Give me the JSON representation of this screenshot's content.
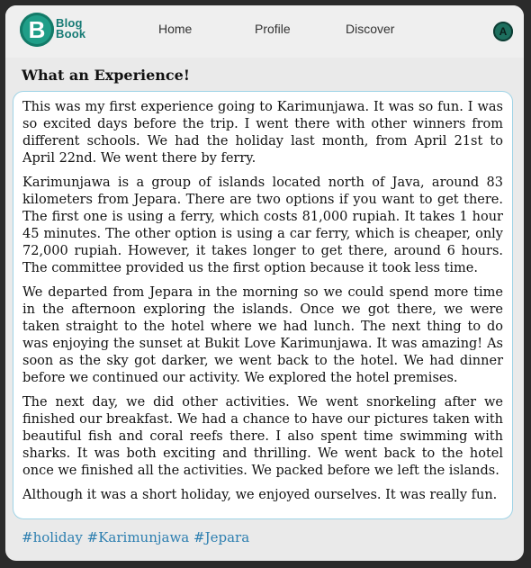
{
  "header": {
    "logo": {
      "mark": "B",
      "line1": "Blog",
      "line2": "Book"
    },
    "nav": {
      "home": "Home",
      "profile": "Profile",
      "discover": "Discover"
    },
    "avatar": "A"
  },
  "post": {
    "title": "What an Experience!",
    "paragraphs": [
      "This was my first experience going to Karimunjawa. It was so fun. I was so excited days before the trip. I went there with other winners from different schools. We had the holiday last month, from April 21st to April 22nd. We went there by ferry.",
      "Karimunjawa is a group of islands located north of Java, around 83 kilometers from Jepara. There are two options if you want to get there. The first one is using a ferry, which costs 81,000 rupiah. It takes 1 hour 45 minutes. The other option is using a car ferry, which is cheaper, only 72,000 rupiah. However, it takes longer to get there, around 6 hours. The committee provided us the first option because it took less time.",
      "We departed from Jepara in the morning so we could spend more time in the afternoon exploring the islands. Once we got there, we were taken straight to the hotel where we had lunch. The next thing to do was enjoying the sunset at Bukit Love Karimunjawa. It was amazing! As soon as the sky got darker, we went back to the hotel. We had dinner before we continued our activity. We explored the hotel premises.",
      "The next day, we did other activities. We went snorkeling after we finished our breakfast. We had a chance to have our pictures taken with beautiful fish and coral reefs there. I also spent time swimming with sharks. It was both exciting and thrilling. We went back to the hotel once we finished all the activities. We packed before we left the islands.",
      "Although it was a short holiday, we enjoyed ourselves. It was really fun."
    ],
    "hashtags": "#holiday #Karimunjawa #Jepara"
  },
  "colors": {
    "brand": "#1f9e88",
    "hashtag": "#2d7fb0",
    "post_border": "#9fd3e6"
  }
}
